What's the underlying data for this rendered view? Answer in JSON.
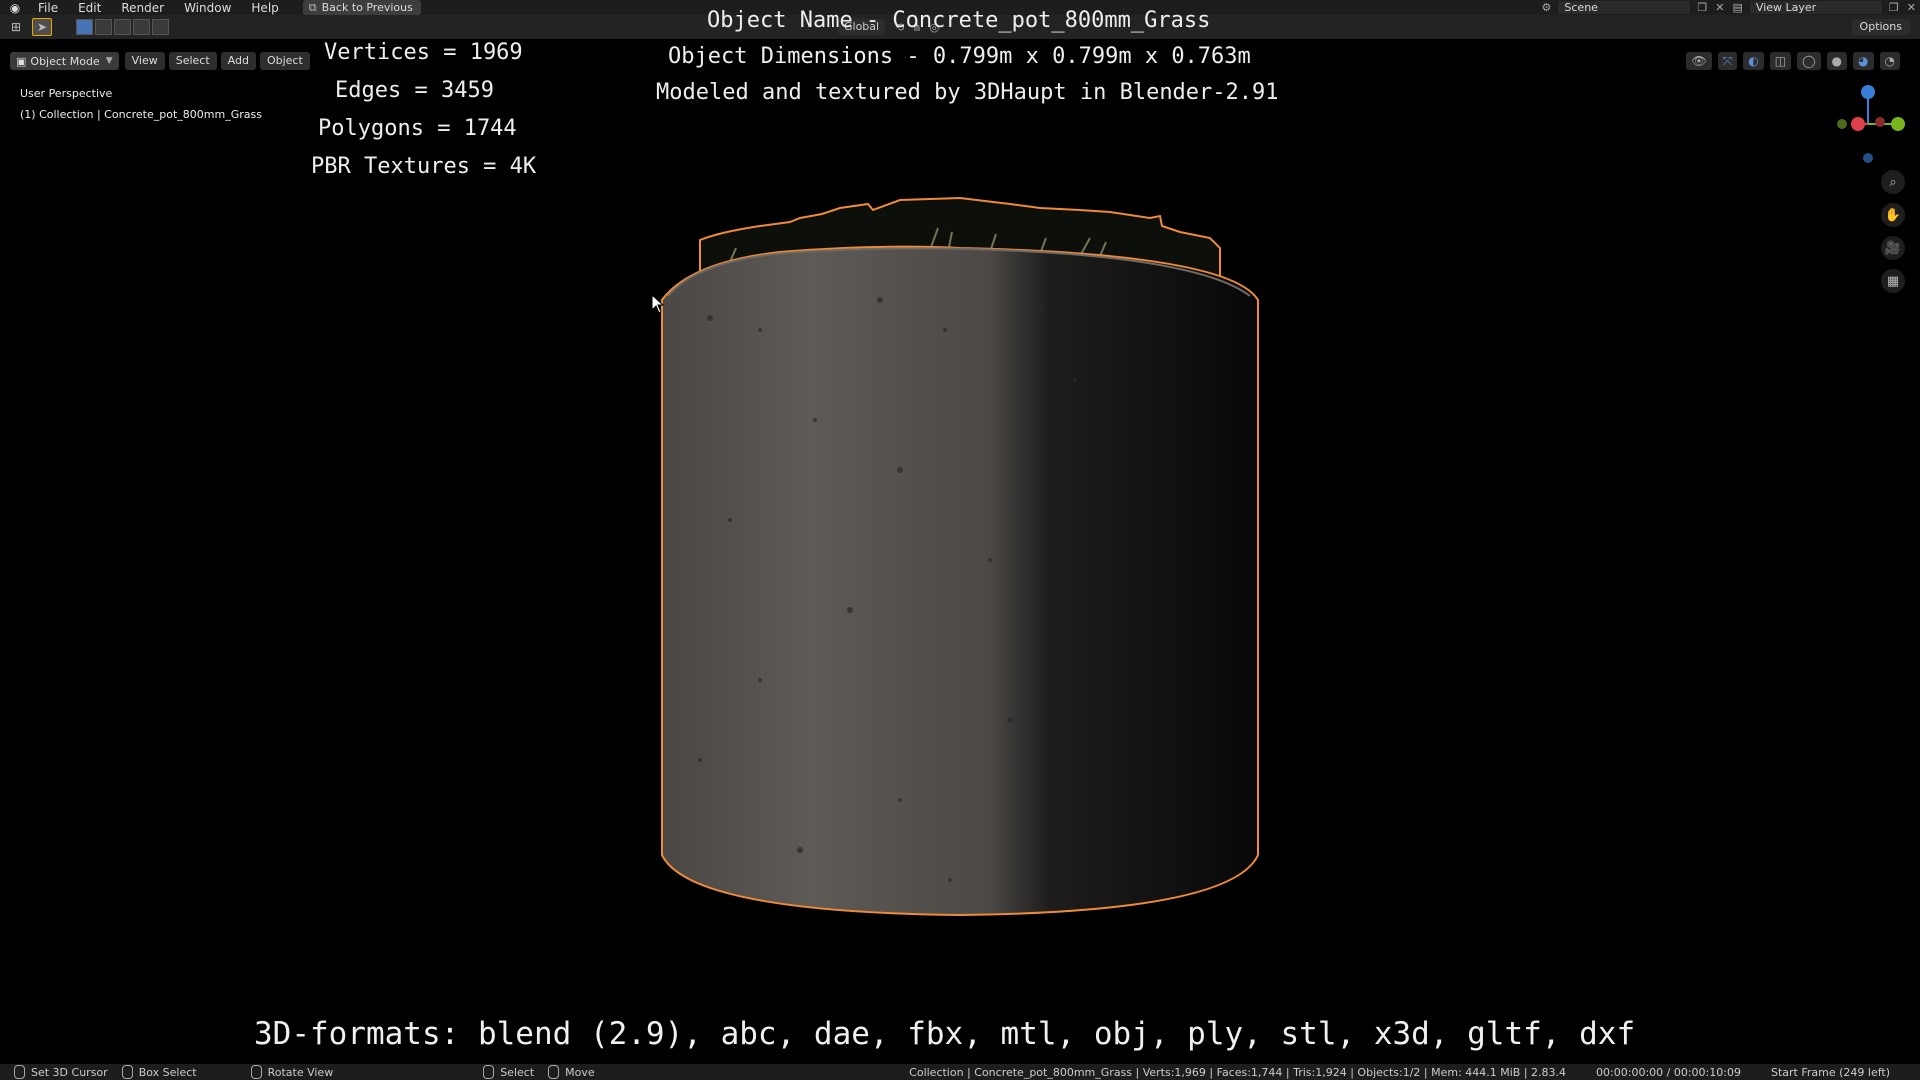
{
  "menubar": {
    "items": [
      "File",
      "Edit",
      "Render",
      "Window",
      "Help"
    ],
    "back_button": "Back to Previous",
    "scene_label": "Scene",
    "view_layer_label": "View Layer"
  },
  "tool_header": {
    "transform_orientation": "Global",
    "options_label": "Options"
  },
  "viewport_header": {
    "mode": "Object Mode",
    "menus": [
      "View",
      "Select",
      "Add",
      "Object"
    ]
  },
  "viewport_overlay": {
    "perspective": "User Perspective",
    "collection": "(1) Collection | Concrete_pot_800mm_Grass"
  },
  "stats": {
    "vertices": "Vertices = 1969",
    "edges": "Edges = 3459",
    "polygons": "Polygons = 1744",
    "textures": "PBR Textures = 4K"
  },
  "caption": {
    "title": "Object Name - Concrete_pot_800mm_Grass",
    "dimensions": "Object Dimensions -  0.799m x 0.799m x 0.763m",
    "credit": "Modeled and textured by 3DHaupt in Blender-2.91",
    "formats": "3D-formats: blend (2.9), abc, dae, fbx, mtl, obj, ply, stl, x3d, gltf, dxf"
  },
  "gizmo": {
    "axis_x": "X",
    "axis_y": "Y",
    "axis_z": "Z",
    "colors": {
      "x": "#e0404a",
      "y": "#7ab51e",
      "z": "#3a7fd6"
    }
  },
  "statusbar": {
    "left": [
      "Set 3D Cursor",
      "Box Select",
      "Rotate View",
      "Select",
      "Move"
    ],
    "scene_stats": "Collection | Concrete_pot_800mm_Grass | Verts:1,969 | Faces:1,744 | Tris:1,924 | Objects:1/2 | Mem: 444.1 MiB | 2.83.4",
    "timecode": "00:00:00:00 / 00:00:10:09",
    "frame": "Start Frame (249 left)"
  },
  "colors": {
    "selection_outline": "#f08a36",
    "accent": "#4772b3"
  }
}
